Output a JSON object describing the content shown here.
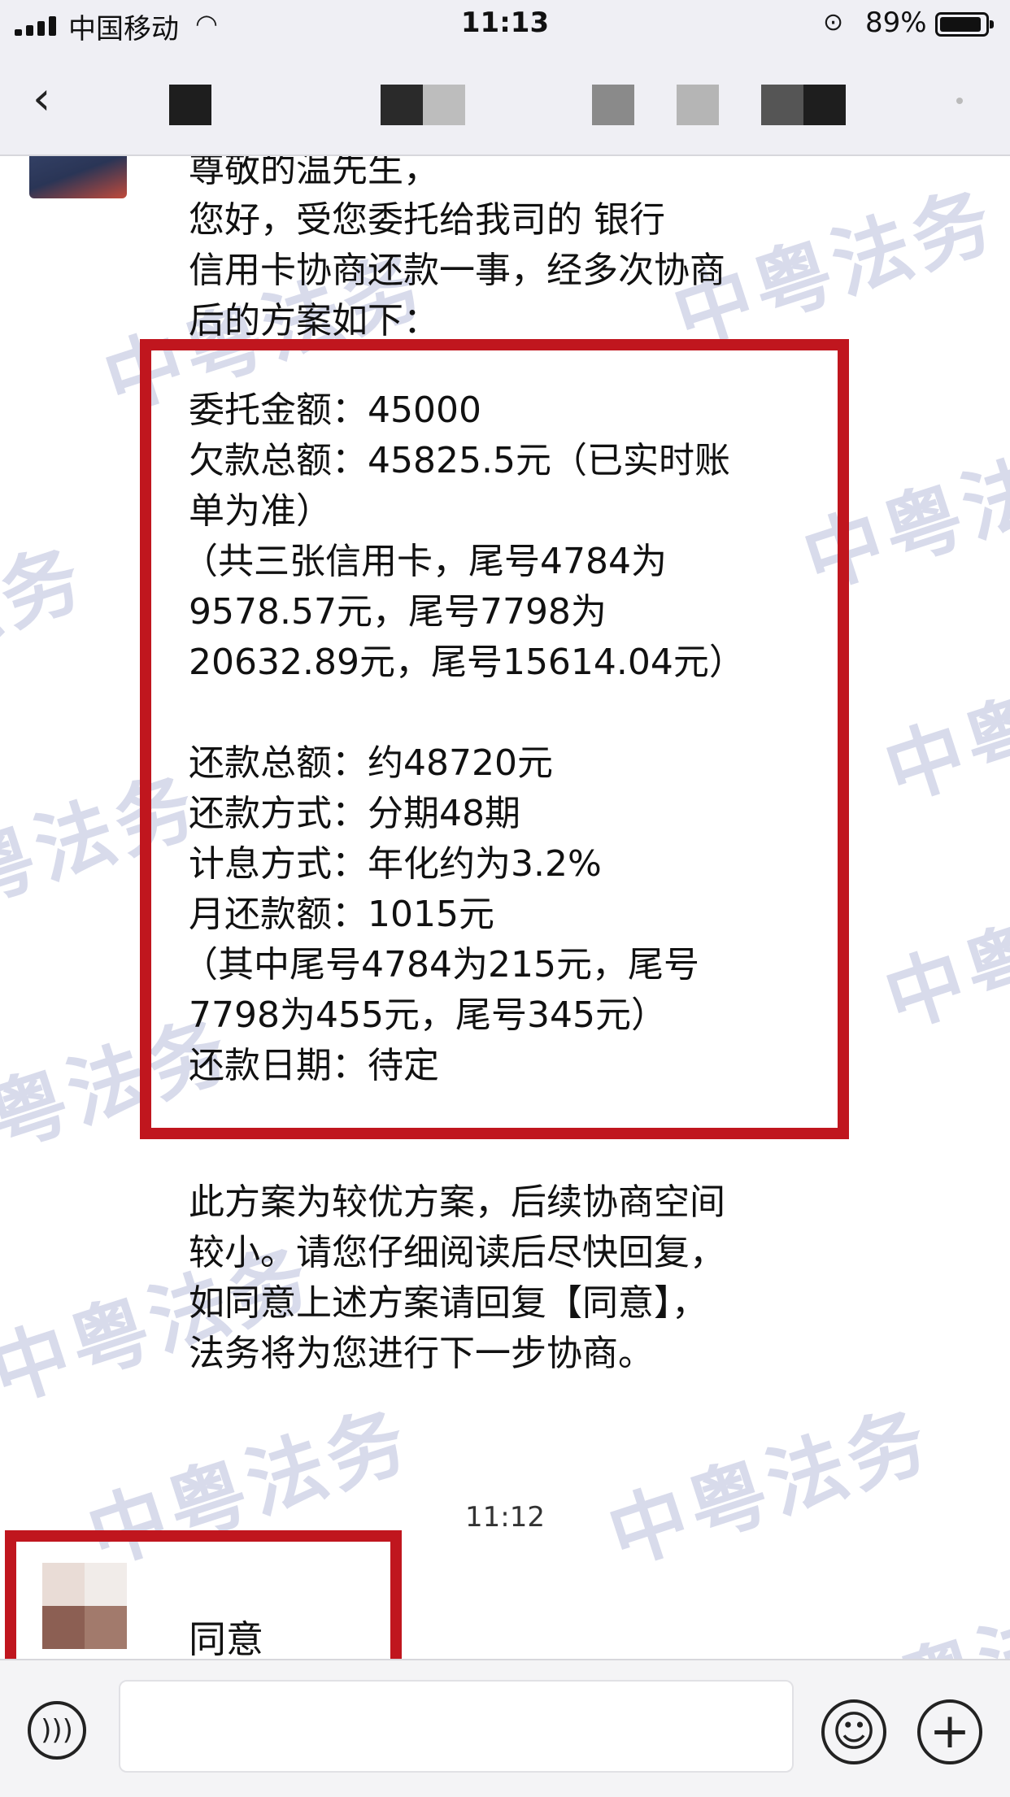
{
  "status_bar": {
    "carrier": "中国移动",
    "time": "11:13",
    "battery_percent": "89%"
  },
  "nav": {
    "back_icon": "chevron-left-icon"
  },
  "chat": {
    "intro_lines": [
      "尊敬的温先生，",
      "您好，受您委托给我司的      银行",
      "信用卡协商还款一事，经多次协商",
      "后的方案如下："
    ],
    "plan_lines": [
      "委托金额：45000",
      "欠款总额：45825.5元（已实时账",
      "单为准）",
      "（共三张信用卡，尾号4784为",
      "9578.57元，尾号7798为",
      "20632.89元，尾号15614.04元）",
      "",
      "还款总额：约48720元",
      "还款方式：分期48期",
      "计息方式：年化约为3.2%",
      "月还款额：1015元",
      "（其中尾号4784为215元，尾号",
      "7798为455元，尾号345元）",
      "还款日期：待定"
    ],
    "closing_lines": [
      "此方案为较优方案，后续协商空间",
      "较小。请您仔细阅读后尽快回复，",
      "如同意上述方案请回复【同意】，",
      "法务将为您进行下一步协商。"
    ],
    "timestamp": "11:12",
    "reply": "同意",
    "watermark": "中粤法务"
  },
  "input_bar": {
    "voice_icon": "voice-icon",
    "emoji_icon": "emoji-icon",
    "plus_icon": "plus-icon"
  },
  "colors": {
    "highlight_border": "#c0161e",
    "bar_background": "#efeff4",
    "watermark": "#b9bedb"
  }
}
